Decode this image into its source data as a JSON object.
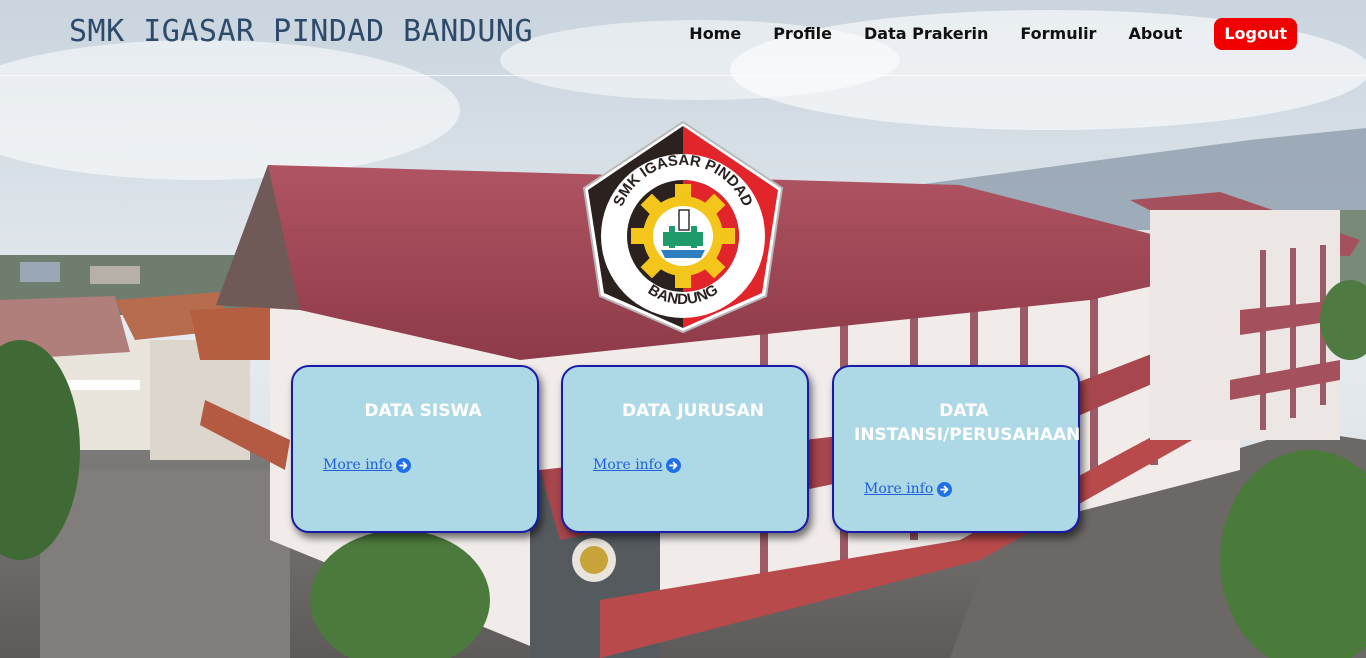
{
  "header": {
    "brand": "SMK IGASAR PINDAD BANDUNG",
    "nav": [
      "Home",
      "Profile",
      "Data Prakerin",
      "Formulir",
      "About"
    ],
    "logout_label": "Logout"
  },
  "logo": {
    "top_text": "SMK IGASAR PINDAD",
    "bottom_text": "BANDUNG"
  },
  "cards": [
    {
      "title": "DATA SISWA",
      "link": "More info"
    },
    {
      "title": "DATA JURUSAN",
      "link": "More info"
    },
    {
      "title": "DATA INSTANSI/PERUSAHAAN",
      "link": "More info"
    }
  ],
  "colors": {
    "card_bg": "#add8e6",
    "card_border": "#1a1aa8",
    "logout_bg": "#f00000",
    "brand_text": "#2e4a6b"
  }
}
